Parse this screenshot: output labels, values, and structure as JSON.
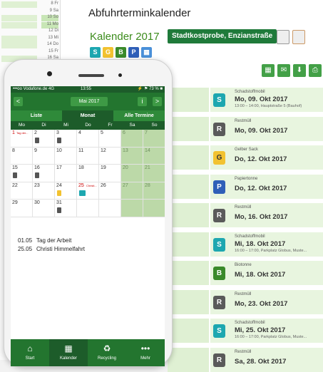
{
  "web": {
    "title": "Abfuhrterminkalender",
    "year_heading": "Kalender 2017",
    "location_button": "Stadtkostprobe, Enzianstraße",
    "sidebar_days": [
      "8 Fr",
      "9 Sa",
      "10 So",
      "11 Mo",
      "12 Di",
      "13 Mi",
      "14 Do",
      "15 Fr",
      "16 Sa"
    ],
    "filter_icons": [
      {
        "icon": "schadstoff-icon",
        "letter": "S",
        "color": "#1da7b0"
      },
      {
        "icon": "gelber-sack-icon",
        "letter": "G",
        "color": "#f2c230"
      },
      {
        "icon": "biotonne-icon",
        "letter": "B",
        "color": "#3a8a2a"
      },
      {
        "icon": "papiertonne-icon",
        "letter": "P",
        "color": "#2f5fb8"
      },
      {
        "icon": "calendar-icon",
        "letter": "▦",
        "color": "#4a90d9"
      }
    ],
    "actions": [
      {
        "icon": "calendar-icon",
        "glyph": "▦"
      },
      {
        "icon": "mail-icon",
        "glyph": "✉"
      },
      {
        "icon": "download-icon",
        "glyph": "⬇"
      },
      {
        "icon": "print-icon",
        "glyph": "⎙"
      }
    ],
    "events": [
      {
        "type": "Schadstoffmobil",
        "letter": "S",
        "kind": "s",
        "date": "Mo, 09. Okt 2017",
        "sub": "13:00 – 14:00, Hauptstraße 5 (Bauhof)"
      },
      {
        "type": "Restmüll",
        "letter": "R",
        "kind": "r",
        "date": "Mo, 09. Okt 2017",
        "sub": ""
      },
      {
        "type": "Gelber Sack",
        "letter": "G",
        "kind": "g",
        "date": "Do, 12. Okt 2017",
        "sub": ""
      },
      {
        "type": "Papiertonne",
        "letter": "P",
        "kind": "p",
        "date": "Do, 12. Okt 2017",
        "sub": ""
      },
      {
        "type": "Restmüll",
        "letter": "R",
        "kind": "r",
        "date": "Mo, 16. Okt 2017",
        "sub": ""
      },
      {
        "type": "Schadstoffmobil",
        "letter": "S",
        "kind": "s",
        "date": "Mi, 18. Okt 2017",
        "sub": "16:00 – 17:00, Parkplatz Globus, Muste..."
      },
      {
        "type": "Biotonne",
        "letter": "B",
        "kind": "b",
        "date": "Mi, 18. Okt 2017",
        "sub": ""
      },
      {
        "type": "Restmüll",
        "letter": "R",
        "kind": "r",
        "date": "Mo, 23. Okt 2017",
        "sub": ""
      },
      {
        "type": "Schadstoffmobil",
        "letter": "S",
        "kind": "s",
        "date": "Mi, 25. Okt 2017",
        "sub": "16:00 – 17:00, Parkplatz Globus, Muste..."
      },
      {
        "type": "Restmüll",
        "letter": "R",
        "kind": "r",
        "date": "Sa, 28. Okt 2017",
        "sub": ""
      }
    ]
  },
  "phone": {
    "status": {
      "carrier": "•••oo Vodafone.de  4G",
      "time": "13:55",
      "battery": "⚡ ⚑ 73 % ■"
    },
    "month_label": "Mai 2017",
    "prev": "<",
    "next": ">",
    "info": "i",
    "tabs": [
      "Liste",
      "Monat",
      "Alle Termine"
    ],
    "active_tab": "Monat",
    "weekdays": [
      "Mo",
      "Di",
      "Mi",
      "Do",
      "Fr",
      "Sa",
      "So"
    ],
    "weeks": [
      [
        {
          "d": "1",
          "tag": "Tag der..."
        },
        {
          "d": "2",
          "bin": "r"
        },
        {
          "d": "3",
          "bin": "r"
        },
        {
          "d": "4"
        },
        {
          "d": "5"
        },
        {
          "d": "6",
          "we": true
        },
        {
          "d": "7",
          "we": true
        }
      ],
      [
        {
          "d": "8"
        },
        {
          "d": "9"
        },
        {
          "d": "10"
        },
        {
          "d": "11"
        },
        {
          "d": "12"
        },
        {
          "d": "13",
          "we": true
        },
        {
          "d": "14",
          "we": true
        }
      ],
      [
        {
          "d": "15",
          "bin": "r"
        },
        {
          "d": "16",
          "bin": "r"
        },
        {
          "d": "17"
        },
        {
          "d": "18"
        },
        {
          "d": "19"
        },
        {
          "d": "20",
          "we": true
        },
        {
          "d": "21",
          "we": true
        }
      ],
      [
        {
          "d": "22"
        },
        {
          "d": "23"
        },
        {
          "d": "24",
          "bin": "g"
        },
        {
          "d": "25",
          "tag": "Christi...",
          "bin": "s"
        },
        {
          "d": "26"
        },
        {
          "d": "27",
          "we": true
        },
        {
          "d": "28",
          "we": true
        }
      ],
      [
        {
          "d": "29"
        },
        {
          "d": "30"
        },
        {
          "d": "31",
          "bin": "r"
        },
        {
          "d": ""
        },
        {
          "d": ""
        },
        {
          "d": "",
          "we": true
        },
        {
          "d": "",
          "we": true
        }
      ]
    ],
    "holidays": [
      {
        "date": "01.05",
        "name": "Tag der Arbeit"
      },
      {
        "date": "25.05",
        "name": "Christi Himmelfahrt"
      }
    ],
    "tabbar": [
      {
        "icon": "home-icon",
        "glyph": "⌂",
        "label": "Start"
      },
      {
        "icon": "calendar-icon",
        "glyph": "▦",
        "label": "Kalender",
        "active": true
      },
      {
        "icon": "recycling-icon",
        "glyph": "♻",
        "label": "Recycling"
      },
      {
        "icon": "more-icon",
        "glyph": "•••",
        "label": "Mehr"
      }
    ]
  }
}
